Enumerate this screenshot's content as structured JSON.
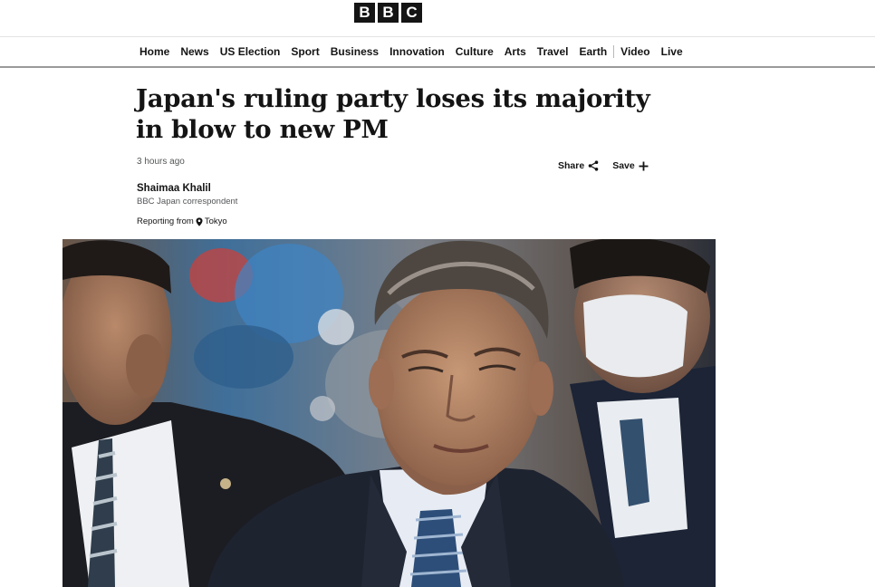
{
  "brand": {
    "logo_letters": [
      "B",
      "B",
      "C"
    ]
  },
  "nav": {
    "items": [
      "Home",
      "News",
      "US Election",
      "Sport",
      "Business",
      "Innovation",
      "Culture",
      "Arts",
      "Travel",
      "Earth",
      "Video",
      "Live"
    ]
  },
  "article": {
    "headline": "Japan's ruling party loses its majority in blow to new PM",
    "timestamp": "3 hours ago",
    "share_label": "Share",
    "save_label": "Save",
    "author_name": "Shaimaa Khalil",
    "author_role": "BBC Japan correspondent",
    "reporting_prefix": "Reporting from",
    "location": "Tokyo"
  },
  "icons": {
    "share": "share-icon",
    "save": "plus-icon",
    "location": "location-pin-icon"
  },
  "colors": {
    "text": "#141414",
    "muted": "#545658",
    "logo_bg": "#141414"
  }
}
